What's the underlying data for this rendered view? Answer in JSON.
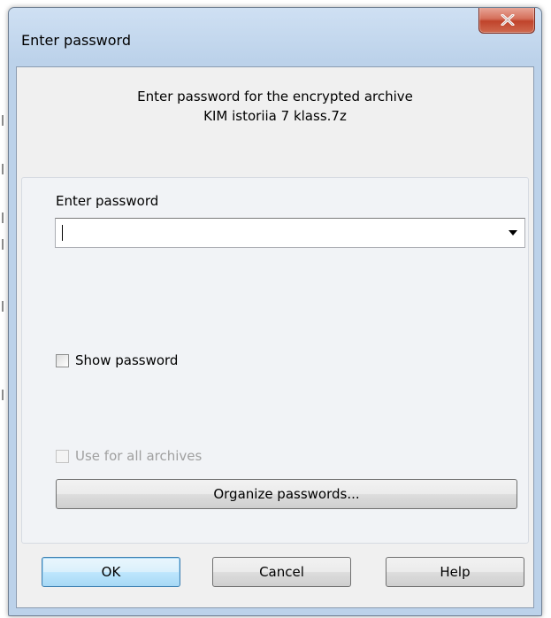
{
  "window": {
    "title": "Enter password"
  },
  "info": {
    "line1": "Enter password for the encrypted archive",
    "line2": "KIM istoriia 7 klass.7z"
  },
  "password_field": {
    "label": "Enter password",
    "value": ""
  },
  "options": {
    "show_password_label": "Show password",
    "show_password_checked": false,
    "use_for_all_label": "Use for all archives",
    "use_for_all_checked": false,
    "use_for_all_enabled": false
  },
  "buttons": {
    "organize": "Organize passwords...",
    "ok": "OK",
    "cancel": "Cancel",
    "help": "Help"
  },
  "icons": {
    "close": "close-icon",
    "dropdown": "chevron-down-icon"
  },
  "colors": {
    "title_bar": "#bcd2ea",
    "close_button": "#c0432b",
    "default_button_border": "#3c7fb1"
  }
}
